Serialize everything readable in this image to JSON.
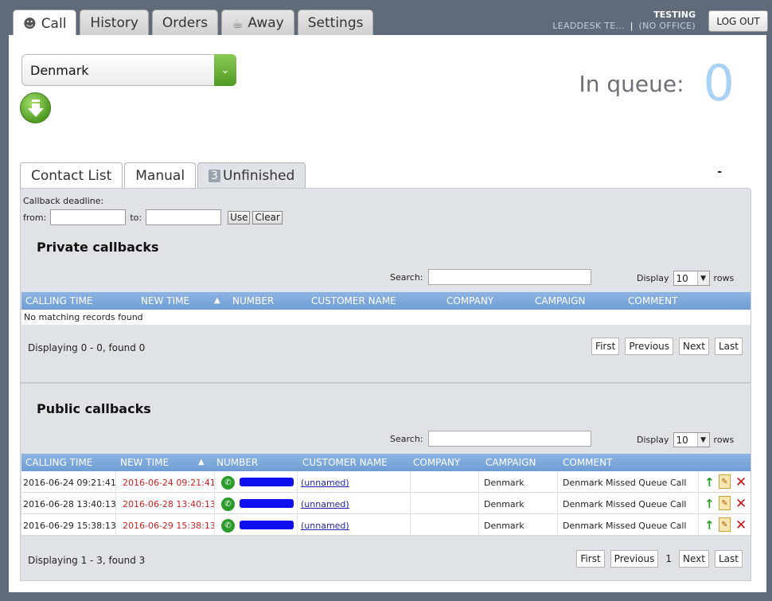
{
  "top_tabs": [
    {
      "label": "Call",
      "icon": "agent-icon"
    },
    {
      "label": "History"
    },
    {
      "label": "Orders"
    },
    {
      "label": "Away",
      "icon": "coffee-cup-icon"
    },
    {
      "label": "Settings"
    }
  ],
  "user": {
    "name": "TESTING",
    "org": "LEADDESK TE...",
    "separator": "|",
    "office": "(NO OFFICE)"
  },
  "logout_label": "LOG OUT",
  "country": {
    "selected": "Denmark"
  },
  "queue": {
    "label": "In queue:",
    "count": "0"
  },
  "sub_tabs": [
    {
      "label": "Contact List"
    },
    {
      "label": "Manual"
    },
    {
      "label": "Unfinished",
      "badge": "3"
    }
  ],
  "dash_text": "-",
  "callback_filter": {
    "label": "Callback deadline:",
    "from_label": "from:",
    "to_label": "to:",
    "from_value": "",
    "to_value": "",
    "use_label": "Use",
    "clear_label": "Clear"
  },
  "private_callbacks": {
    "title": "Private callbacks",
    "search_label": "Search:",
    "search_value": "",
    "display_label": "Display",
    "display_value": "10",
    "rows_label": "rows",
    "columns": [
      "CALLING TIME",
      "NEW TIME",
      "NUMBER",
      "CUSTOMER NAME",
      "COMPANY",
      "CAMPAIGN",
      "COMMENT"
    ],
    "empty_text": "No matching records found",
    "status": "Displaying 0 - 0, found 0",
    "pager": {
      "first": "First",
      "previous": "Previous",
      "next": "Next",
      "last": "Last"
    }
  },
  "public_callbacks": {
    "title": "Public callbacks",
    "search_label": "Search:",
    "search_value": "",
    "display_label": "Display",
    "display_value": "10",
    "rows_label": "rows",
    "columns": [
      "CALLING TIME",
      "NEW TIME",
      "NUMBER",
      "CUSTOMER NAME",
      "COMPANY",
      "CAMPAIGN",
      "COMMENT"
    ],
    "rows": [
      {
        "calling_time": "2016-06-24 09:21:41",
        "new_time": "2016-06-24 09:21:41",
        "customer": "(unnamed)",
        "company": "",
        "campaign": "Denmark",
        "comment": "Denmark Missed Queue Call"
      },
      {
        "calling_time": "2016-06-28 13:40:13",
        "new_time": "2016-06-28 13:40:13",
        "customer": "(unnamed)",
        "company": "",
        "campaign": "Denmark",
        "comment": "Denmark Missed Queue Call"
      },
      {
        "calling_time": "2016-06-29 15:38:13",
        "new_time": "2016-06-29 15:38:13",
        "customer": "(unnamed)",
        "company": "",
        "campaign": "Denmark",
        "comment": "Denmark Missed Queue Call"
      }
    ],
    "status": "Displaying 1 - 3, found 3",
    "pager": {
      "first": "First",
      "previous": "Previous",
      "page": "1",
      "next": "Next",
      "last": "Last"
    }
  }
}
